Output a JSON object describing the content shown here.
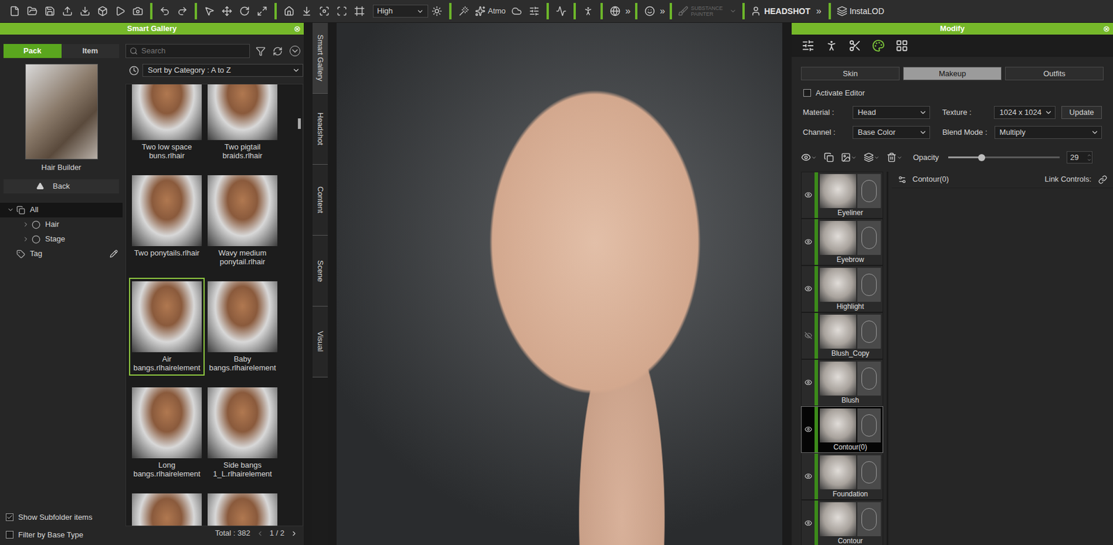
{
  "toolbar": {
    "quality": "High",
    "atmo": "Atmo",
    "substance": "SUBSTANCE PAINTER",
    "headshot": "HEADSHOT",
    "instalod": "InstaLOD",
    "overflow": "»"
  },
  "gallery": {
    "title": "Smart Gallery",
    "close": "⊗",
    "tabs": [
      {
        "label": "Pack",
        "selected": true
      },
      {
        "label": "Item",
        "selected": false
      }
    ],
    "pack_name": "Hair Builder",
    "back": "Back",
    "tree": [
      {
        "label": "All",
        "kind": "root",
        "expanded": true,
        "selected": true
      },
      {
        "label": "Hair",
        "kind": "folder",
        "expanded": false,
        "selected": false
      },
      {
        "label": "Stage",
        "kind": "folder",
        "expanded": false,
        "selected": false
      },
      {
        "label": "Tag",
        "kind": "tag",
        "expanded": false,
        "selected": false
      }
    ],
    "search_placeholder": "Search",
    "sort": "Sort by Category : A to Z",
    "items": [
      {
        "label": "Two low space buns.rlhair",
        "selected": false
      },
      {
        "label": "Two pigtail braids.rlhair",
        "selected": false
      },
      {
        "label": "Two ponytails.rlhair",
        "selected": false
      },
      {
        "label": "Wavy medium ponytail.rlhair",
        "selected": false
      },
      {
        "label": "Air bangs.rlhairelement",
        "selected": true
      },
      {
        "label": "Baby bangs.rlhairelement",
        "selected": false
      },
      {
        "label": "Long bangs.rlhairelement",
        "selected": false
      },
      {
        "label": "Side bangs 1_L.rlhairelement",
        "selected": false
      },
      {
        "label": "",
        "selected": false
      },
      {
        "label": "",
        "selected": false
      }
    ],
    "total": "Total : 382",
    "page": "1 / 2",
    "options": [
      {
        "label": "Show Subfolder items",
        "checked": true
      },
      {
        "label": "Filter by Base Type",
        "checked": false
      }
    ]
  },
  "side_tabs": [
    {
      "label": "Smart Gallery",
      "selected": true
    },
    {
      "label": "Headshot",
      "selected": false
    },
    {
      "label": "Content",
      "selected": false
    },
    {
      "label": "Scene",
      "selected": false
    },
    {
      "label": "Visual",
      "selected": false
    }
  ],
  "modify": {
    "title": "Modify",
    "close": "⊗",
    "tool_tabs": [
      {
        "selected": false
      },
      {
        "selected": false
      },
      {
        "selected": false
      },
      {
        "selected": true
      },
      {
        "selected": false
      }
    ],
    "sub_tabs": [
      {
        "label": "Skin",
        "selected": false
      },
      {
        "label": "Makeup",
        "selected": true
      },
      {
        "label": "Outfits",
        "selected": false
      }
    ],
    "activate_editor": {
      "label": "Activate Editor",
      "checked": false
    },
    "material_label": "Material :",
    "material": "Head",
    "texture_label": "Texture :",
    "texture": "1024 x 1024",
    "update": "Update",
    "channel_label": "Channel :",
    "channel": "Base Color",
    "blend_label": "Blend Mode :",
    "blend": "Multiply",
    "opacity": {
      "label": "Opacity",
      "level": 0.3,
      "value": "29"
    },
    "layers": [
      {
        "name": "Eyeliner",
        "visible": true,
        "selected": false
      },
      {
        "name": "Eyebrow",
        "visible": true,
        "selected": false
      },
      {
        "name": "Highlight",
        "visible": true,
        "selected": false
      },
      {
        "name": "Blush_Copy",
        "visible": false,
        "selected": false
      },
      {
        "name": "Blush",
        "visible": true,
        "selected": false
      },
      {
        "name": "Contour(0)",
        "visible": true,
        "selected": true
      },
      {
        "name": "Foundation",
        "visible": true,
        "selected": false
      },
      {
        "name": "Contour",
        "visible": true,
        "selected": false
      }
    ],
    "detail_title": "Contour(0)",
    "link_controls": "Link Controls:"
  }
}
